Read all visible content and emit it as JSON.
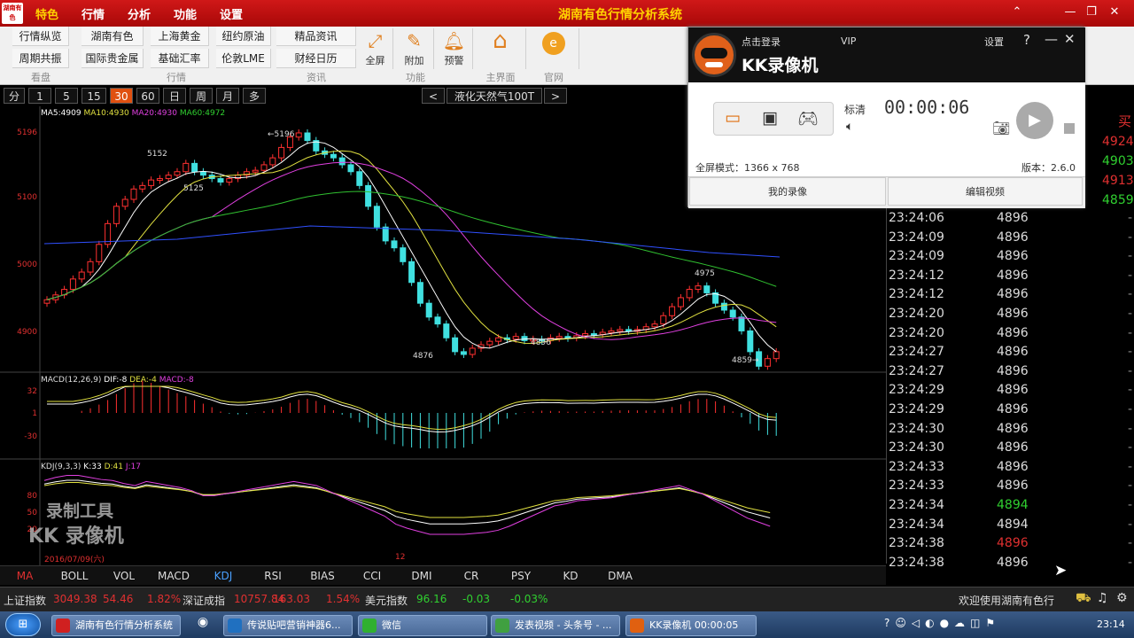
{
  "titlebar": {
    "logo_text": "湖南有色",
    "menu": [
      "特色",
      "行情",
      "分析",
      "功能",
      "设置"
    ],
    "active_menu": "特色",
    "app_title": "湖南有色行情分析系统"
  },
  "toolbar": {
    "rows": [
      [
        "行情纵览",
        "湖南有色",
        "上海黄金",
        "纽约原油",
        "精品资讯"
      ],
      [
        "周期共振",
        "国际贵金属",
        "基础汇率",
        "伦敦LME",
        "财经日历"
      ]
    ],
    "groups": [
      "看盘",
      "行情",
      "资讯",
      "功能",
      "主界面",
      "官网"
    ],
    "big_buttons": [
      {
        "label": "全屏",
        "icon": "fullscreen-icon"
      },
      {
        "label": "附加",
        "icon": "pin-icon"
      },
      {
        "label": "预警",
        "icon": "bell-icon"
      },
      {
        "label": "",
        "icon": "home-icon"
      },
      {
        "label": "",
        "icon": "coin-icon"
      }
    ]
  },
  "period_bar": {
    "periods": [
      "分",
      "1",
      "5",
      "15",
      "30",
      "60",
      "日",
      "周",
      "月",
      "多"
    ],
    "active_period": "30",
    "prev": "<",
    "instrument": "液化天然气100T",
    "next": ">"
  },
  "main_chart": {
    "ma_line": {
      "ma5": "MA5:4909",
      "ma10": "MA10:4930",
      "ma20": "MA20:4930",
      "ma60": "MA60:4972"
    },
    "y_labels": [
      "5196",
      "5100",
      "5000",
      "4900"
    ],
    "annotations": [
      "5196",
      "5152",
      "5125",
      "4876",
      "4896",
      "4975",
      "4859"
    ]
  },
  "macd": {
    "title": "MACD(12,26,9)",
    "dif": "DIF:-8",
    "dea": "DEA:-4",
    "macd": "MACD:-8",
    "y_labels": [
      "32",
      "1",
      "-30"
    ]
  },
  "kdj": {
    "title": "KDJ(9,3,3)",
    "k": "K:33",
    "d": "D:41",
    "j": "J:17",
    "y_labels": [
      "80",
      "50",
      "20"
    ],
    "date": "2016/07/09(六)",
    "mid_label": "12",
    "watermark1": "录制工具",
    "watermark2": "KK 录像机"
  },
  "right_panel": {
    "header_label": "买",
    "top_prices": [
      {
        "value": "4924",
        "color": "#e03030"
      },
      {
        "value": "4903",
        "color": "#30d030"
      },
      {
        "value": "4913",
        "color": "#e03030"
      },
      {
        "value": "4859",
        "color": "#30d030"
      }
    ],
    "ticks": [
      {
        "time": "23:24:06",
        "price": "4896",
        "color": "#dddddd"
      },
      {
        "time": "23:24:09",
        "price": "4896",
        "color": "#dddddd"
      },
      {
        "time": "23:24:09",
        "price": "4896",
        "color": "#dddddd"
      },
      {
        "time": "23:24:12",
        "price": "4896",
        "color": "#dddddd"
      },
      {
        "time": "23:24:12",
        "price": "4896",
        "color": "#dddddd"
      },
      {
        "time": "23:24:20",
        "price": "4896",
        "color": "#dddddd"
      },
      {
        "time": "23:24:20",
        "price": "4896",
        "color": "#dddddd"
      },
      {
        "time": "23:24:27",
        "price": "4896",
        "color": "#dddddd"
      },
      {
        "time": "23:24:27",
        "price": "4896",
        "color": "#dddddd"
      },
      {
        "time": "23:24:29",
        "price": "4896",
        "color": "#dddddd"
      },
      {
        "time": "23:24:29",
        "price": "4896",
        "color": "#dddddd"
      },
      {
        "time": "23:24:30",
        "price": "4896",
        "color": "#dddddd"
      },
      {
        "time": "23:24:30",
        "price": "4896",
        "color": "#dddddd"
      },
      {
        "time": "23:24:33",
        "price": "4896",
        "color": "#dddddd"
      },
      {
        "time": "23:24:33",
        "price": "4896",
        "color": "#dddddd"
      },
      {
        "time": "23:24:34",
        "price": "4894",
        "color": "#30d030"
      },
      {
        "time": "23:24:34",
        "price": "4894",
        "color": "#dddddd"
      },
      {
        "time": "23:24:38",
        "price": "4896",
        "color": "#e03030"
      },
      {
        "time": "23:24:38",
        "price": "4896",
        "color": "#dddddd"
      }
    ]
  },
  "indicator_tabs": [
    "MA",
    "BOLL",
    "VOL",
    "MACD",
    "KDJ",
    "RSI",
    "BIAS",
    "CCI",
    "DMI",
    "CR",
    "PSY",
    "KD",
    "DMA"
  ],
  "active_tab": "MA",
  "status": {
    "sh_label": "上证指数",
    "sh_value": "3049.38",
    "sh_change": "54.46",
    "sh_pct": "1.82%",
    "sz_label": "深证成指",
    "sz_value": "10757.84",
    "sz_change": "163.03",
    "sz_pct": "1.54%",
    "usd_label": "美元指数",
    "usd_value": "96.16",
    "usd_change": "-0.03",
    "usd_pct": "-0.03%",
    "welcome": "欢迎使用湖南有色行"
  },
  "taskbar": {
    "tasks": [
      {
        "label": "湖南有色行情分析系统",
        "color": "#d02020"
      },
      {
        "label": "传说贴吧营销神器6...",
        "color": "#2070c0"
      },
      {
        "label": "微信",
        "color": "#30b030"
      },
      {
        "label": "发表视频 - 头条号 - ...",
        "color": "#40a040"
      },
      {
        "label": "KK录像机 00:00:05",
        "color": "#e06010"
      }
    ],
    "clock": "23:14"
  },
  "kk_recorder": {
    "login": "点击登录",
    "vip": "VIP",
    "brand": "KK录像机",
    "settings": "设置",
    "help": "?",
    "quality": "标清",
    "timer": "00:00:06",
    "mode_label": "全屏模式：1366 x 768",
    "version": "版本：2.6.0",
    "my_videos": "我的录像",
    "edit_video": "编辑视频"
  }
}
